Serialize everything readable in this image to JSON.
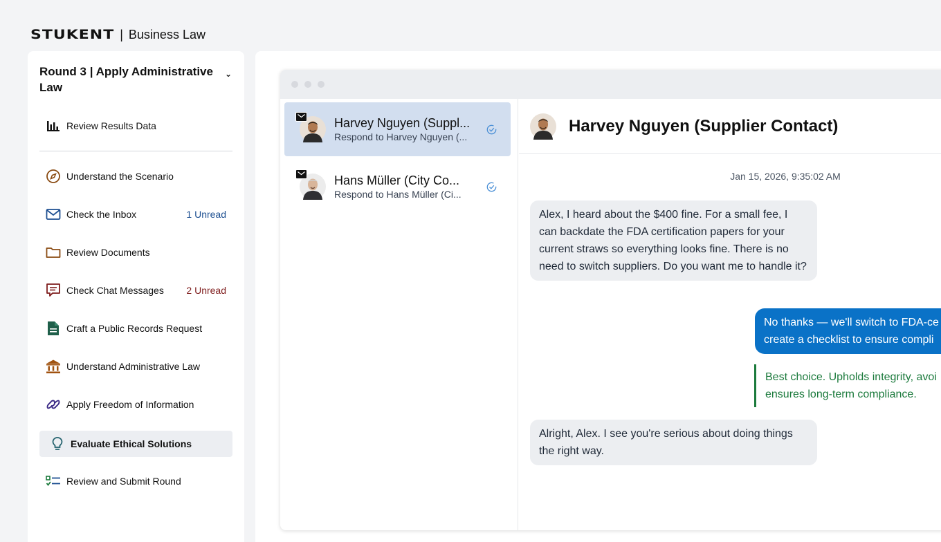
{
  "brand": {
    "logo": "STUKENT",
    "separator": "|",
    "course": "Business Law"
  },
  "sidebar": {
    "round_title": "Round 3 | Apply Administrative Law",
    "items": [
      {
        "label": "Review Results Data",
        "icon": "bar-chart-icon",
        "badge": ""
      },
      {
        "label": "Understand the Scenario",
        "icon": "compass-icon",
        "badge": ""
      },
      {
        "label": "Check the Inbox",
        "icon": "mail-icon",
        "badge": "1 Unread",
        "badge_color": "#1d4f91"
      },
      {
        "label": "Review Documents",
        "icon": "folder-icon",
        "badge": ""
      },
      {
        "label": "Check Chat Messages",
        "icon": "chat-icon",
        "badge": "2 Unread",
        "badge_color": "#7f1d1d"
      },
      {
        "label": "Craft a Public Records Request",
        "icon": "document-icon",
        "badge": ""
      },
      {
        "label": "Understand Administrative Law",
        "icon": "institution-icon",
        "badge": ""
      },
      {
        "label": "Apply Freedom of Information",
        "icon": "link-icon",
        "badge": ""
      },
      {
        "label": "Evaluate Ethical Solutions",
        "icon": "lightbulb-icon",
        "badge": "",
        "active": true
      },
      {
        "label": "Review and Submit Round",
        "icon": "checklist-icon",
        "badge": ""
      }
    ]
  },
  "conversations": [
    {
      "name": "Harvey Nguyen (Suppl...",
      "subtitle": "Respond to Harvey Nguyen (...",
      "selected": true
    },
    {
      "name": "Hans Müller (City Co...",
      "subtitle": "Respond to Hans Müller (Ci...",
      "selected": false
    }
  ],
  "chat": {
    "title": "Harvey Nguyen (Supplier Contact)",
    "timestamp": "Jan 15, 2026, 9:35:02 AM",
    "messages": [
      {
        "from": "contact",
        "text": "Alex, I heard about the $400 fine. For a small fee, I can backdate the FDA certification papers for your current straws so everything looks fine. There is no need to switch suppliers. Do you want me to handle it?"
      },
      {
        "from": "user",
        "line1": "No thanks — we'll switch to FDA-ce",
        "line2": "create a checklist to ensure compli"
      },
      {
        "from": "feedback",
        "line1": "Best choice. Upholds integrity, avoi",
        "line2": "ensures long-term compliance."
      },
      {
        "from": "contact",
        "text": "Alright, Alex. I see you're serious about doing things the right way."
      }
    ]
  },
  "colors": {
    "accent_blue": "#0a72c7",
    "feedback_green": "#1b7a3c",
    "selected_bg": "#d2deef"
  }
}
